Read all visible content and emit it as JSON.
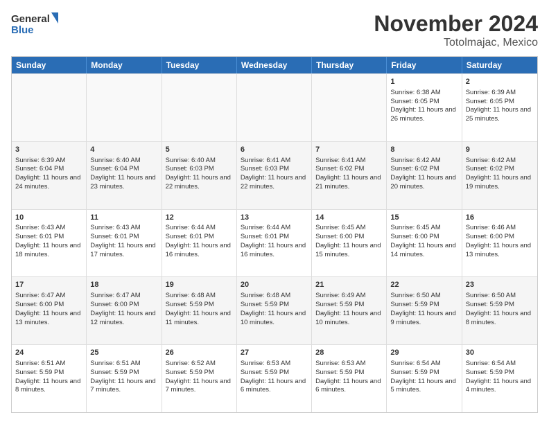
{
  "logo": {
    "line1": "General",
    "line2": "Blue"
  },
  "title": "November 2024",
  "location": "Totolmajac, Mexico",
  "days": [
    "Sunday",
    "Monday",
    "Tuesday",
    "Wednesday",
    "Thursday",
    "Friday",
    "Saturday"
  ],
  "rows": [
    [
      {
        "day": "",
        "info": ""
      },
      {
        "day": "",
        "info": ""
      },
      {
        "day": "",
        "info": ""
      },
      {
        "day": "",
        "info": ""
      },
      {
        "day": "",
        "info": ""
      },
      {
        "day": "1",
        "info": "Sunrise: 6:38 AM\nSunset: 6:05 PM\nDaylight: 11 hours and 26 minutes."
      },
      {
        "day": "2",
        "info": "Sunrise: 6:39 AM\nSunset: 6:05 PM\nDaylight: 11 hours and 25 minutes."
      }
    ],
    [
      {
        "day": "3",
        "info": "Sunrise: 6:39 AM\nSunset: 6:04 PM\nDaylight: 11 hours and 24 minutes."
      },
      {
        "day": "4",
        "info": "Sunrise: 6:40 AM\nSunset: 6:04 PM\nDaylight: 11 hours and 23 minutes."
      },
      {
        "day": "5",
        "info": "Sunrise: 6:40 AM\nSunset: 6:03 PM\nDaylight: 11 hours and 22 minutes."
      },
      {
        "day": "6",
        "info": "Sunrise: 6:41 AM\nSunset: 6:03 PM\nDaylight: 11 hours and 22 minutes."
      },
      {
        "day": "7",
        "info": "Sunrise: 6:41 AM\nSunset: 6:02 PM\nDaylight: 11 hours and 21 minutes."
      },
      {
        "day": "8",
        "info": "Sunrise: 6:42 AM\nSunset: 6:02 PM\nDaylight: 11 hours and 20 minutes."
      },
      {
        "day": "9",
        "info": "Sunrise: 6:42 AM\nSunset: 6:02 PM\nDaylight: 11 hours and 19 minutes."
      }
    ],
    [
      {
        "day": "10",
        "info": "Sunrise: 6:43 AM\nSunset: 6:01 PM\nDaylight: 11 hours and 18 minutes."
      },
      {
        "day": "11",
        "info": "Sunrise: 6:43 AM\nSunset: 6:01 PM\nDaylight: 11 hours and 17 minutes."
      },
      {
        "day": "12",
        "info": "Sunrise: 6:44 AM\nSunset: 6:01 PM\nDaylight: 11 hours and 16 minutes."
      },
      {
        "day": "13",
        "info": "Sunrise: 6:44 AM\nSunset: 6:01 PM\nDaylight: 11 hours and 16 minutes."
      },
      {
        "day": "14",
        "info": "Sunrise: 6:45 AM\nSunset: 6:00 PM\nDaylight: 11 hours and 15 minutes."
      },
      {
        "day": "15",
        "info": "Sunrise: 6:45 AM\nSunset: 6:00 PM\nDaylight: 11 hours and 14 minutes."
      },
      {
        "day": "16",
        "info": "Sunrise: 6:46 AM\nSunset: 6:00 PM\nDaylight: 11 hours and 13 minutes."
      }
    ],
    [
      {
        "day": "17",
        "info": "Sunrise: 6:47 AM\nSunset: 6:00 PM\nDaylight: 11 hours and 13 minutes."
      },
      {
        "day": "18",
        "info": "Sunrise: 6:47 AM\nSunset: 6:00 PM\nDaylight: 11 hours and 12 minutes."
      },
      {
        "day": "19",
        "info": "Sunrise: 6:48 AM\nSunset: 5:59 PM\nDaylight: 11 hours and 11 minutes."
      },
      {
        "day": "20",
        "info": "Sunrise: 6:48 AM\nSunset: 5:59 PM\nDaylight: 11 hours and 10 minutes."
      },
      {
        "day": "21",
        "info": "Sunrise: 6:49 AM\nSunset: 5:59 PM\nDaylight: 11 hours and 10 minutes."
      },
      {
        "day": "22",
        "info": "Sunrise: 6:50 AM\nSunset: 5:59 PM\nDaylight: 11 hours and 9 minutes."
      },
      {
        "day": "23",
        "info": "Sunrise: 6:50 AM\nSunset: 5:59 PM\nDaylight: 11 hours and 8 minutes."
      }
    ],
    [
      {
        "day": "24",
        "info": "Sunrise: 6:51 AM\nSunset: 5:59 PM\nDaylight: 11 hours and 8 minutes."
      },
      {
        "day": "25",
        "info": "Sunrise: 6:51 AM\nSunset: 5:59 PM\nDaylight: 11 hours and 7 minutes."
      },
      {
        "day": "26",
        "info": "Sunrise: 6:52 AM\nSunset: 5:59 PM\nDaylight: 11 hours and 7 minutes."
      },
      {
        "day": "27",
        "info": "Sunrise: 6:53 AM\nSunset: 5:59 PM\nDaylight: 11 hours and 6 minutes."
      },
      {
        "day": "28",
        "info": "Sunrise: 6:53 AM\nSunset: 5:59 PM\nDaylight: 11 hours and 6 minutes."
      },
      {
        "day": "29",
        "info": "Sunrise: 6:54 AM\nSunset: 5:59 PM\nDaylight: 11 hours and 5 minutes."
      },
      {
        "day": "30",
        "info": "Sunrise: 6:54 AM\nSunset: 5:59 PM\nDaylight: 11 hours and 4 minutes."
      }
    ]
  ]
}
